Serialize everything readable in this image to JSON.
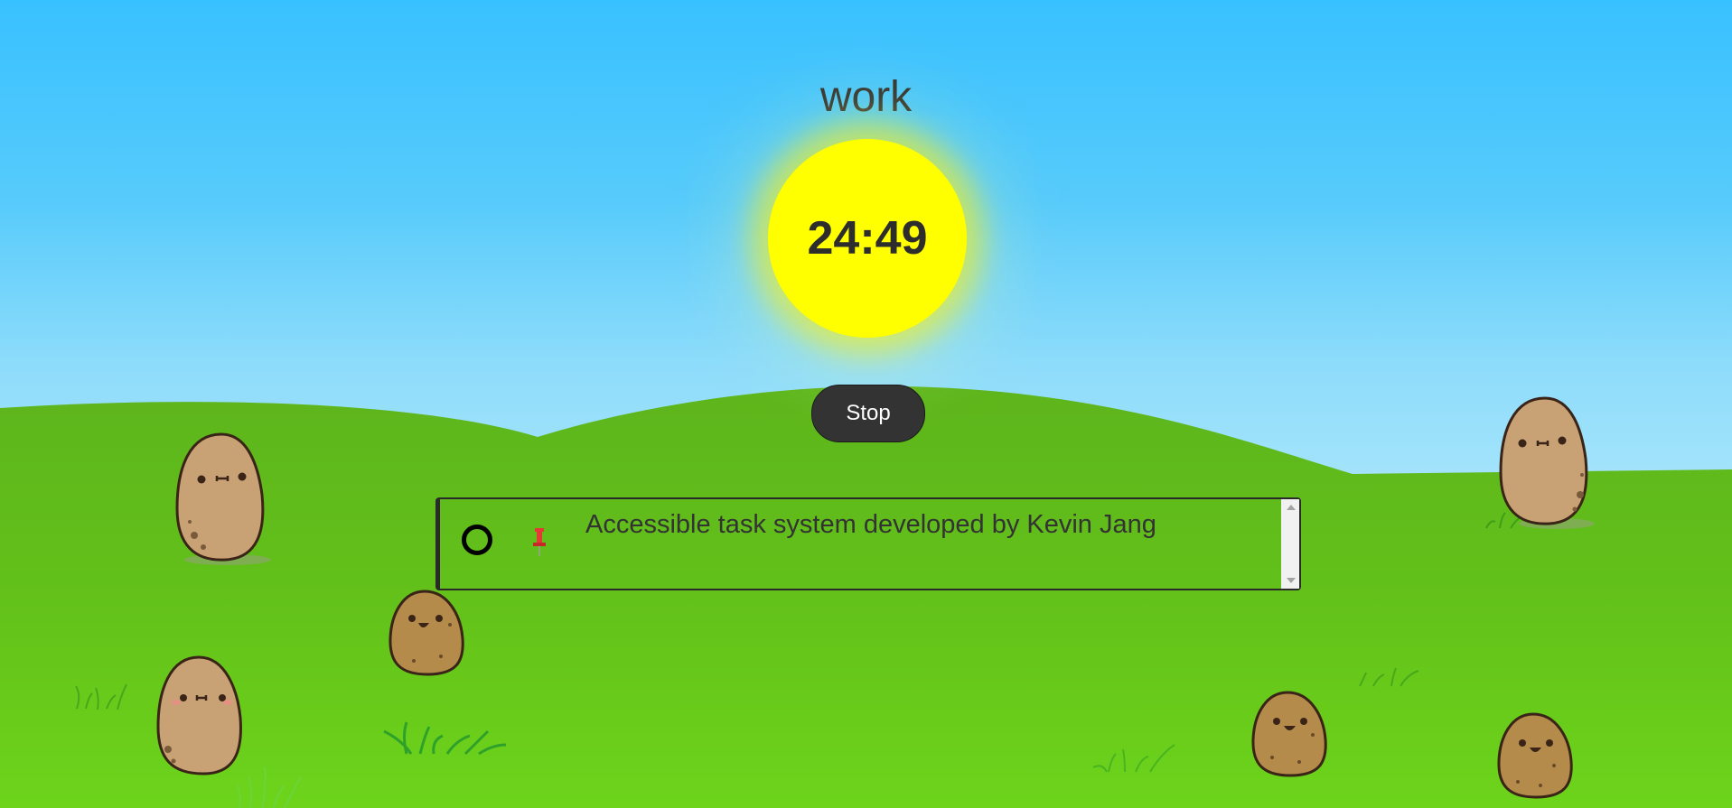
{
  "mode": {
    "label": "work"
  },
  "timer": {
    "display": "24:49"
  },
  "controls": {
    "stop_label": "Stop"
  },
  "tasks": [
    {
      "text": "Accessible task system developed by Kevin Jang",
      "completed": false,
      "pinned": true
    }
  ],
  "icons": {
    "check": "circle-checkbox-icon",
    "pin": "pushpin-icon"
  },
  "colors": {
    "sky_top": "#38c1ff",
    "sky_bottom": "#a5e4fb",
    "grass": "#66c71a",
    "sun": "#ffff00",
    "button": "#333333",
    "text": "#2f2f2f"
  }
}
